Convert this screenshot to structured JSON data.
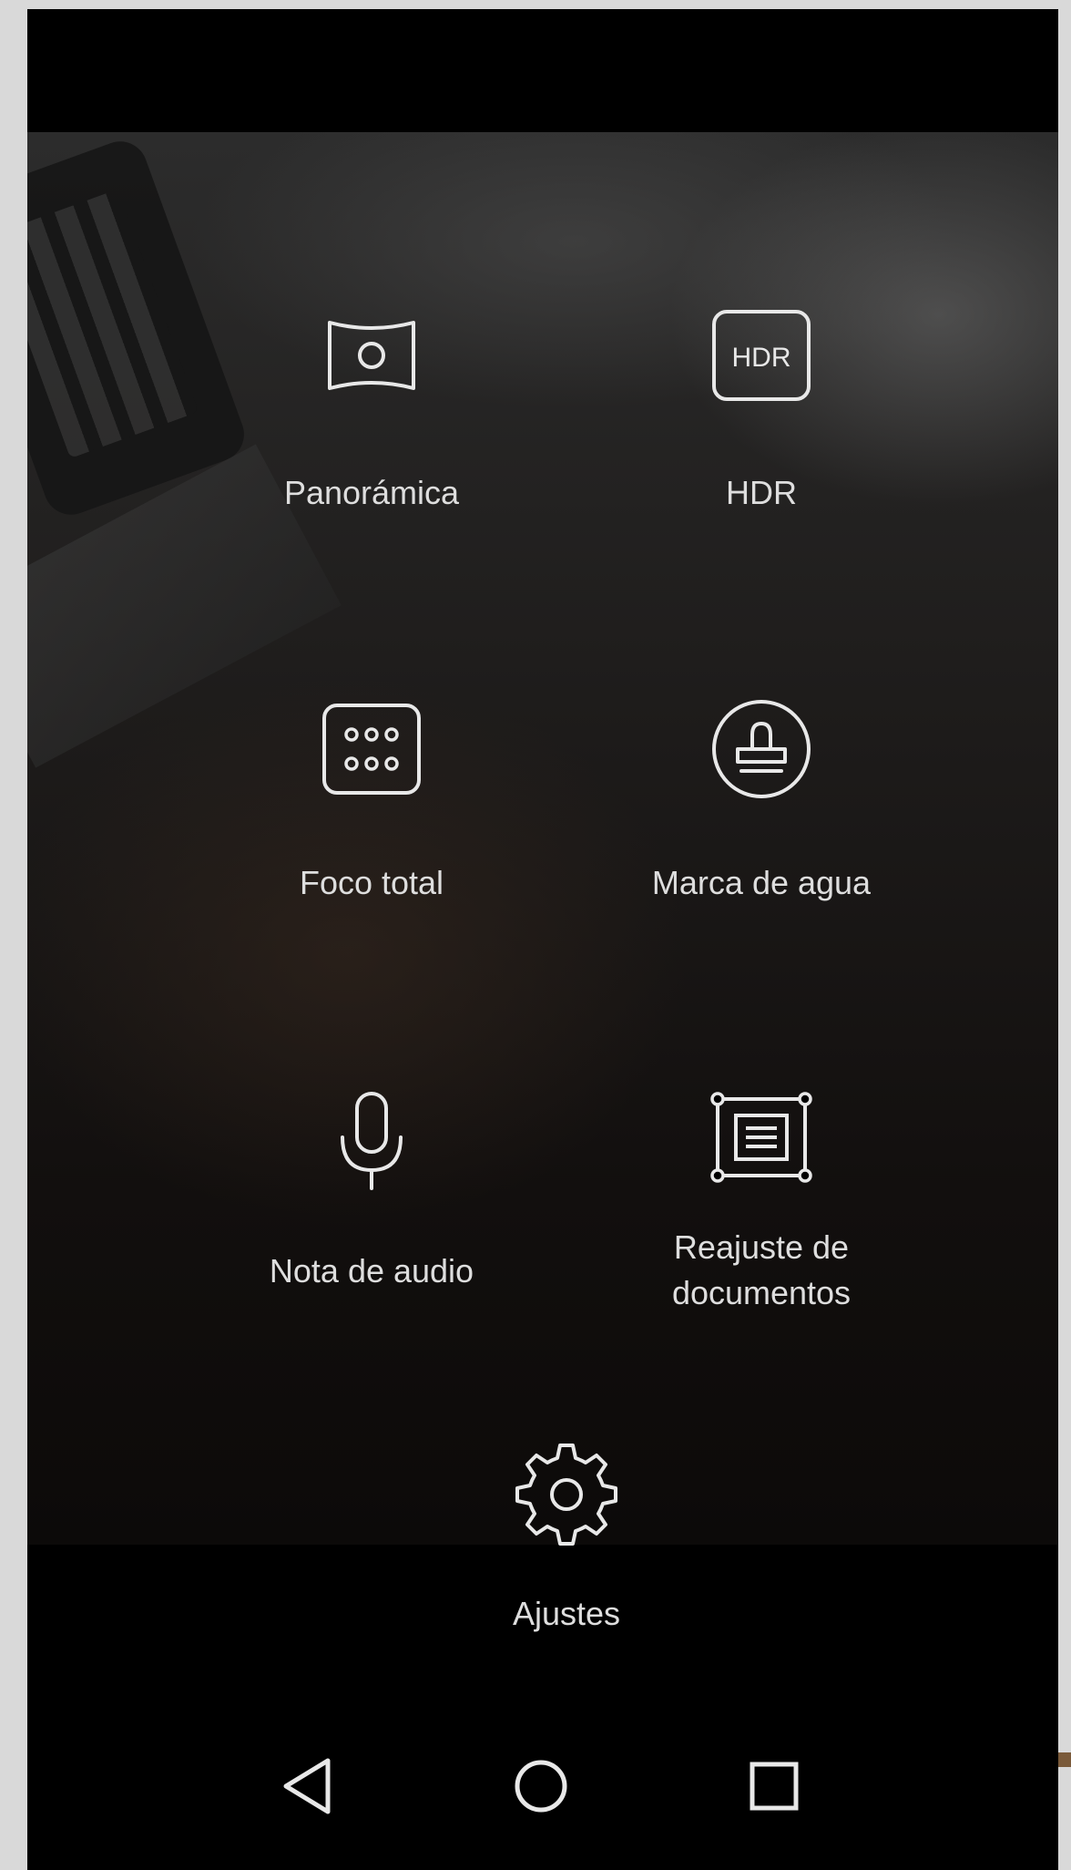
{
  "modes": [
    {
      "label": "Panorámica",
      "icon": "panorama-icon"
    },
    {
      "label": "HDR",
      "icon": "hdr-icon",
      "badge": "HDR"
    },
    {
      "label": "Foco total",
      "icon": "all-focus-icon"
    },
    {
      "label": "Marca de agua",
      "icon": "watermark-stamp-icon"
    },
    {
      "label": "Nota de audio",
      "icon": "microphone-icon"
    },
    {
      "label": "Reajuste de\ndocumentos",
      "icon": "document-adjust-icon"
    }
  ],
  "settings": {
    "label": "Ajustes",
    "icon": "gear-icon"
  },
  "navigation": {
    "back": "back-triangle-icon",
    "home": "home-circle-icon",
    "recents": "recents-square-icon"
  },
  "colors": {
    "text": "#dedede",
    "icon_stroke": "#e8e8e8",
    "background": "#000000",
    "accent": "#7a5a3a"
  }
}
